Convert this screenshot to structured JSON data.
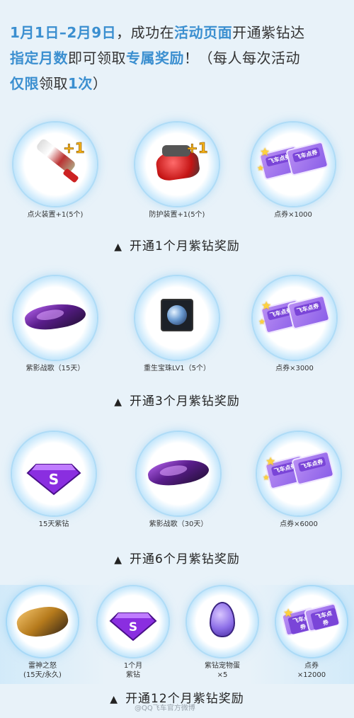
{
  "intro": {
    "p1": "1月1日–2月9日",
    "p2": "，成功在",
    "p3": "活动页面",
    "p4": "开通紫钻达",
    "p5": "指定月数",
    "p6": "即可领取",
    "p7": "专属奖励",
    "p8": "！（每人每次活动",
    "p9": "仅限",
    "p10": "领取",
    "p11": "1次",
    "p12": "）"
  },
  "tiers": [
    {
      "caption": "开通1个月紫钻奖励",
      "items": [
        {
          "label": "点火装置+1(5个)",
          "icon": "igniter-icon",
          "badge": "+1"
        },
        {
          "label": "防护装置+1(5个)",
          "icon": "protector-icon",
          "badge": "+1"
        },
        {
          "label": "点券×1000",
          "icon": "coupon-icon",
          "ticket_text": "飞车点券"
        }
      ]
    },
    {
      "caption": "开通3个月紫钻奖励",
      "items": [
        {
          "label": "紫影战歌（15天）",
          "icon": "kart-icon"
        },
        {
          "label": "重生宝珠LV1（5个）",
          "icon": "orb-icon"
        },
        {
          "label": "点券×3000",
          "icon": "coupon-icon",
          "ticket_text": "飞车点券"
        }
      ]
    },
    {
      "caption": "开通6个月紫钻奖励",
      "items": [
        {
          "label": "15天紫钻",
          "icon": "purple-diamond-icon"
        },
        {
          "label": "紫影战歌（30天）",
          "icon": "kart-icon"
        },
        {
          "label": "点券×6000",
          "icon": "coupon-icon",
          "ticket_text": "飞车点券"
        }
      ]
    },
    {
      "caption": "开通12个月紫钻奖励",
      "items": [
        {
          "label": "雷神之怒\n(15天/永久)",
          "icon": "kart-icon"
        },
        {
          "label": "1个月\n紫钻",
          "icon": "purple-diamond-icon"
        },
        {
          "label": "紫钻宠物蛋\n×5",
          "icon": "pet-egg-icon"
        },
        {
          "label": "点券\n×12000",
          "icon": "coupon-icon",
          "ticket_text": "飞车点券"
        }
      ]
    }
  ],
  "caption_marker": "▲",
  "watermark": "@QQ飞车官方微博",
  "colors": {
    "highlight": "#3b8fd0",
    "background": "#e8f2f9",
    "ring": "#6bc4f3",
    "coupon_purple": "#8a5ee8",
    "badge_gold": "#f7b218"
  }
}
